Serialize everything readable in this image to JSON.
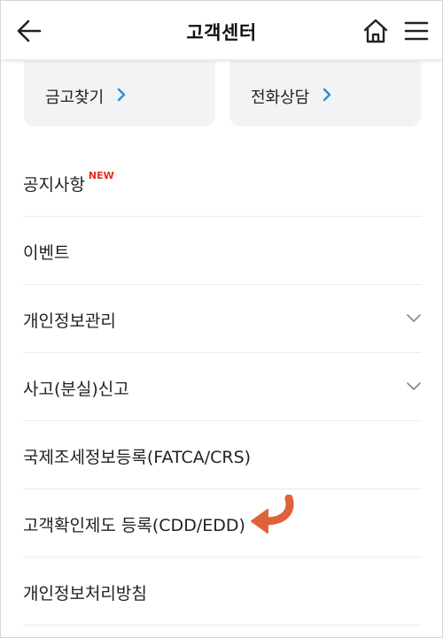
{
  "header": {
    "title": "고객센터",
    "back_icon": "back-arrow-icon",
    "home_icon": "home-icon",
    "menu_icon": "hamburger-menu-icon"
  },
  "quick_links": [
    {
      "label": "금고찾기",
      "icon": "chevron-right-icon"
    },
    {
      "label": "전화상담",
      "icon": "chevron-right-icon"
    }
  ],
  "menu_items": [
    {
      "label": "공지사항",
      "badge": "NEW"
    },
    {
      "label": "이벤트"
    },
    {
      "label": "개인정보관리",
      "icon": "chevron-down-icon"
    },
    {
      "label": "사고(분실)신고",
      "icon": "chevron-down-icon"
    },
    {
      "label": "국제조세정보등록(FATCA/CRS)"
    },
    {
      "label": "고객확인제도 등록(CDD/EDD)",
      "annotation_icon": "curved-arrow-icon"
    },
    {
      "label": "개인정보처리방침"
    }
  ],
  "colors": {
    "accent_chevron": "#2b8fd0",
    "badge": "#e0301e",
    "annotation_arrow": "#e0623a",
    "quick_bg": "#f2f3f5"
  }
}
